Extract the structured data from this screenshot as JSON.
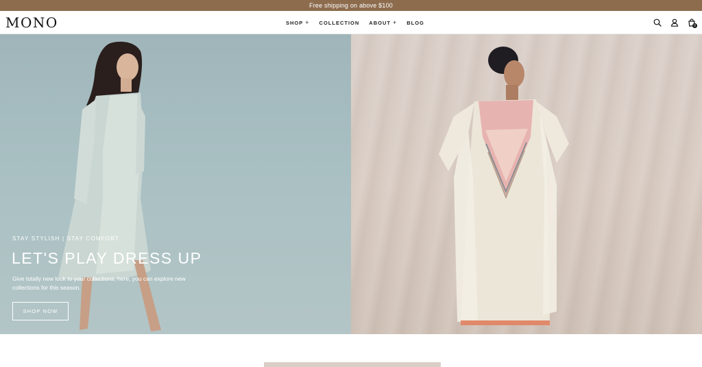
{
  "announcement": {
    "text": "Free shipping on above $100"
  },
  "header": {
    "logo": "MONO",
    "nav": [
      {
        "label": "SHOP",
        "has_plus": true
      },
      {
        "label": "COLLECTION",
        "has_plus": false
      },
      {
        "label": "ABOUT",
        "has_plus": true
      },
      {
        "label": "BLOG",
        "has_plus": false
      }
    ],
    "nav_plus": "+",
    "icons": [
      "search-icon",
      "account-icon",
      "cart-icon"
    ],
    "cart_count": "0"
  },
  "hero": {
    "eyebrow": "STAY STYLISH | STAY COMFORT",
    "headline": "LET'S PLAY DRESS UP",
    "description": "Give totally new look to your collections, here, you can explore new collections for this season.",
    "cta_label": "SHOP NOW"
  },
  "colors": {
    "announcement_bg": "#8d6c4e",
    "hero_left_bg": "#a9c0c3",
    "hero_right_bg": "#d8cbc2"
  }
}
